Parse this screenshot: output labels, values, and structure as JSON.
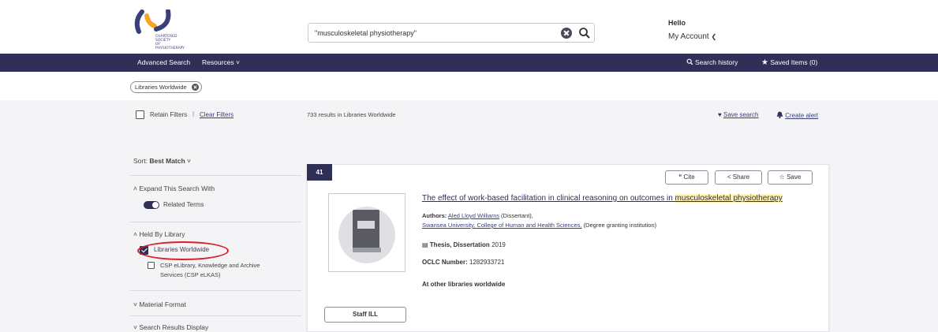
{
  "header": {
    "logo_lines": [
      "CHARTERED",
      "SOCIETY",
      "OF",
      "PHYSIOTHERAPY"
    ],
    "search_value": "\"musculoskeletal physiotherapy\"",
    "greeting": "Hello",
    "account_label": "My Account"
  },
  "nav": {
    "advanced_search": "Advanced Search",
    "resources": "Resources",
    "search_history": "Search history",
    "saved_items": "Saved Items (0)"
  },
  "filters": {
    "chip": "Libraries Worldwide",
    "retain": "Retain Filters",
    "clear": "Clear Filters",
    "results_count": "733 results in Libraries Worldwide",
    "save_search": "Save search",
    "create_alert": "Create alert"
  },
  "sidebar": {
    "sort_label": "Sort:",
    "sort_value": "Best Match",
    "expand_title": "Expand This Search With",
    "related_terms": "Related Terms",
    "held_title": "Held By Library",
    "options": [
      {
        "label": "Libraries Worldwide",
        "checked": true
      },
      {
        "label_line1": "CSP eLibrary, Knowledge and Archive",
        "label_line2": "Services (CSP eLKAS)",
        "checked": false
      }
    ],
    "material_format": "Material Format",
    "results_display": "Search Results Display"
  },
  "result": {
    "number": "41",
    "cite": "Cite",
    "share": "Share",
    "save": "Save",
    "title_part1": "The effect of work-based facilitation in clinical reasoning on outcomes in ",
    "title_highlight": "musculoskeletal physiotherapy",
    "authors_label": "Authors:",
    "author1": "Aled Lloyd Williams",
    "author1_role": "(Dissertant),",
    "author2": "Swansea University, College of Human and Health Sciences,",
    "author2_role": "(Degree granting institution)",
    "type": "Thesis, Dissertation",
    "year": "2019",
    "oclc_label": "OCLC Number:",
    "oclc": "1282933721",
    "availability": "At other libraries worldwide",
    "staff_ill": "Staff ILL"
  },
  "colors": {
    "navy": "#2f2f58",
    "logo_orange": "#f5a623",
    "highlight": "#fff3b0",
    "annotation_red": "#d81f26"
  }
}
